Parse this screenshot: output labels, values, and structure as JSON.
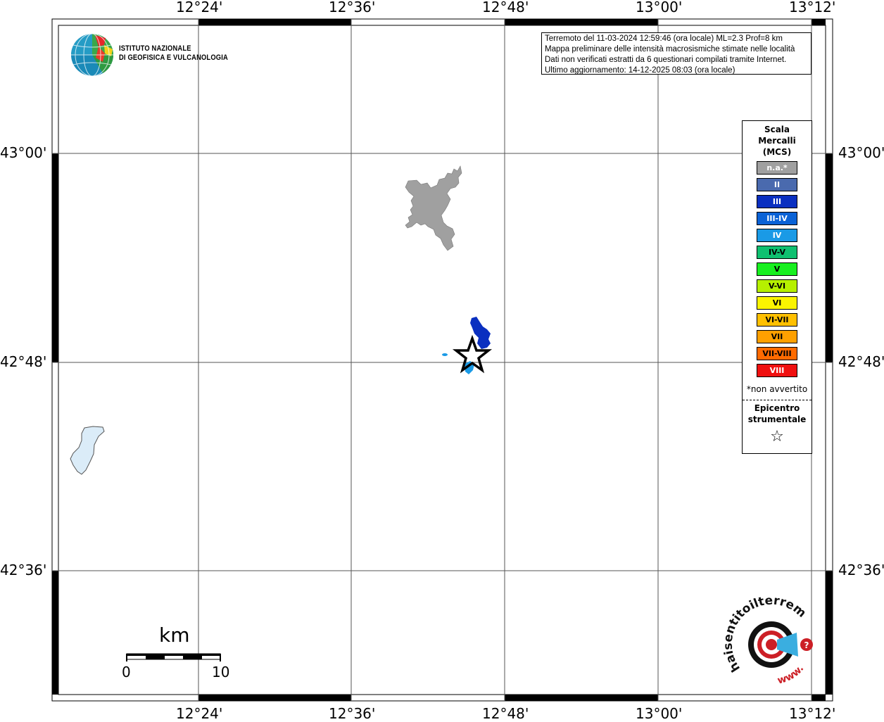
{
  "coords": {
    "lon_labels": [
      "12°24'",
      "12°36'",
      "12°48'",
      "13°00'",
      "13°12'"
    ],
    "lat_labels": [
      "43°00'",
      "42°48'",
      "42°36'"
    ]
  },
  "info": {
    "line1": "Terremoto del 11-03-2024 12:59:46 (ora locale) ML=2.3 Prof=8 km",
    "line2": "Mappa preliminare delle intensità macrosismiche stimate nelle località",
    "line3": "Dati non verificati estratti da 6 questionari compilati tramite Internet.",
    "line4": "Ultimo aggiornamento: 14-12-2025 08:03 (ora locale)"
  },
  "logo": {
    "line1": "ISTITUTO NAZIONALE",
    "line2": "DI GEOFISICA E VULCANOLOGIA"
  },
  "legend": {
    "title1": "Scala",
    "title2": "Mercalli",
    "title3": "(MCS)",
    "items": [
      {
        "label": "n.a.*",
        "color": "#a0a0a0",
        "text": "#ffffff"
      },
      {
        "label": "II",
        "color": "#4a6aae",
        "text": "#ffffff"
      },
      {
        "label": "III",
        "color": "#0a2fc0",
        "text": "#ffffff"
      },
      {
        "label": "III-IV",
        "color": "#0a62d6",
        "text": "#ffffff"
      },
      {
        "label": "IV",
        "color": "#1a9ae6",
        "text": "#ffffff"
      },
      {
        "label": "IV-V",
        "color": "#0fc070",
        "text": "#000000"
      },
      {
        "label": "V",
        "color": "#18f020",
        "text": "#000000"
      },
      {
        "label": "V-VI",
        "color": "#b6f000",
        "text": "#000000"
      },
      {
        "label": "VI",
        "color": "#fbf400",
        "text": "#000000"
      },
      {
        "label": "VI-VII",
        "color": "#ffc000",
        "text": "#000000"
      },
      {
        "label": "VII",
        "color": "#ffa000",
        "text": "#000000"
      },
      {
        "label": "VII-VIII",
        "color": "#ff6a00",
        "text": "#000000"
      },
      {
        "label": "VIII",
        "color": "#f01010",
        "text": "#ffffff"
      }
    ],
    "note": "*non avvertito",
    "epi1": "Epicentro",
    "epi2": "strumentale",
    "epi_symbol": "☆"
  },
  "scalebar": {
    "unit": "km",
    "min": "0",
    "max": "10"
  },
  "hst": {
    "text": "haisentitoilterremoto.it",
    "www": "www.",
    "brand_red": "#cc1f26"
  },
  "colors": {
    "grey_area": "#a0a0a0",
    "intensity_III": "#0a2fc0",
    "intensity_IV": "#1a9ae6",
    "lake": "#dbecf8"
  }
}
